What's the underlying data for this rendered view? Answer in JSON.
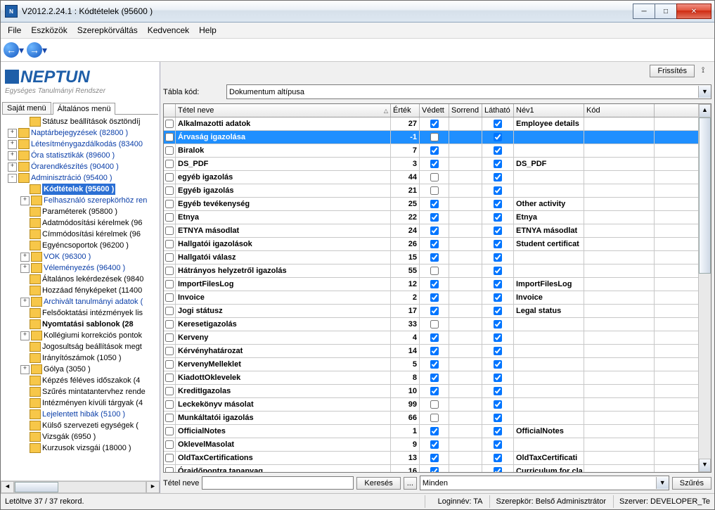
{
  "window": {
    "title": "V2012.2.24.1 : Kódtételek (95600  )"
  },
  "menu": [
    "File",
    "Eszközök",
    "Szerepkörváltás",
    "Kedvencek",
    "Help"
  ],
  "logo": {
    "brand": "NEPTUN",
    "subtitle": "Egységes Tanulmányi Rendszer"
  },
  "left_tabs": {
    "t1": "Saját menü",
    "t2": "Általános menü"
  },
  "tree": [
    {
      "d": 1,
      "tog": "",
      "link": false,
      "bold": false,
      "sel": false,
      "label": "Státusz beállítások ösztöndíj"
    },
    {
      "d": 0,
      "tog": "+",
      "link": true,
      "bold": false,
      "sel": false,
      "label": "Naptárbejegyzések (82800  )"
    },
    {
      "d": 0,
      "tog": "+",
      "link": true,
      "bold": false,
      "sel": false,
      "label": "Létesítménygazdálkodás (83400"
    },
    {
      "d": 0,
      "tog": "+",
      "link": true,
      "bold": false,
      "sel": false,
      "label": "Óra statisztikák (89600  )"
    },
    {
      "d": 0,
      "tog": "+",
      "link": true,
      "bold": false,
      "sel": false,
      "label": "Órarendkészítés (90400  )"
    },
    {
      "d": 0,
      "tog": "-",
      "link": true,
      "bold": false,
      "sel": false,
      "label": "Adminisztráció (95400  )"
    },
    {
      "d": 1,
      "tog": "",
      "link": true,
      "bold": true,
      "sel": true,
      "label": "Kódtételek (95600  )"
    },
    {
      "d": 1,
      "tog": "+",
      "link": true,
      "bold": false,
      "sel": false,
      "label": "Felhasználó szerepkörhöz ren"
    },
    {
      "d": 1,
      "tog": "",
      "link": false,
      "bold": false,
      "sel": false,
      "label": "Paraméterek (95800  )"
    },
    {
      "d": 1,
      "tog": "",
      "link": false,
      "bold": false,
      "sel": false,
      "label": "Adatmódosítási kérelmek (96"
    },
    {
      "d": 1,
      "tog": "",
      "link": false,
      "bold": false,
      "sel": false,
      "label": "Címmódosítási kérelmek (96"
    },
    {
      "d": 1,
      "tog": "",
      "link": false,
      "bold": false,
      "sel": false,
      "label": "Egyéncsoportok (96200  )"
    },
    {
      "d": 1,
      "tog": "+",
      "link": true,
      "bold": false,
      "sel": false,
      "label": "VOK (96300  )"
    },
    {
      "d": 1,
      "tog": "+",
      "link": true,
      "bold": false,
      "sel": false,
      "label": "Véleményezés (96400  )"
    },
    {
      "d": 1,
      "tog": "",
      "link": false,
      "bold": false,
      "sel": false,
      "label": "Általános lekérdezések (9840"
    },
    {
      "d": 1,
      "tog": "",
      "link": false,
      "bold": false,
      "sel": false,
      "label": "Hozzáad fényképeket (11400"
    },
    {
      "d": 1,
      "tog": "+",
      "link": true,
      "bold": false,
      "sel": false,
      "label": "Archivált tanulmányi adatok ("
    },
    {
      "d": 1,
      "tog": "",
      "link": false,
      "bold": false,
      "sel": false,
      "label": "Felsőoktatási intézmények lis"
    },
    {
      "d": 1,
      "tog": "",
      "link": false,
      "bold": true,
      "sel": false,
      "label": "Nyomtatási sablonok (28"
    },
    {
      "d": 1,
      "tog": "+",
      "link": false,
      "bold": false,
      "sel": false,
      "label": "Kollégiumi korrekciós pontok"
    },
    {
      "d": 1,
      "tog": "",
      "link": false,
      "bold": false,
      "sel": false,
      "label": "Jogosultság beállítások megt"
    },
    {
      "d": 1,
      "tog": "",
      "link": false,
      "bold": false,
      "sel": false,
      "label": "Irányítószámok (1050  )"
    },
    {
      "d": 1,
      "tog": "+",
      "link": false,
      "bold": false,
      "sel": false,
      "label": "Gólya (3050  )"
    },
    {
      "d": 1,
      "tog": "",
      "link": false,
      "bold": false,
      "sel": false,
      "label": "Képzés féléves időszakok (4"
    },
    {
      "d": 1,
      "tog": "",
      "link": false,
      "bold": false,
      "sel": false,
      "label": "Szűrés mintatantervhez rende"
    },
    {
      "d": 1,
      "tog": "",
      "link": false,
      "bold": false,
      "sel": false,
      "label": "Intézményen kívüli tárgyak (4"
    },
    {
      "d": 1,
      "tog": "",
      "link": true,
      "bold": false,
      "sel": false,
      "label": "Lejelentett hibák (5100  )"
    },
    {
      "d": 1,
      "tog": "",
      "link": false,
      "bold": false,
      "sel": false,
      "label": "Külső szervezeti egységek ("
    },
    {
      "d": 1,
      "tog": "",
      "link": false,
      "bold": false,
      "sel": false,
      "label": "Vizsgák (6950  )"
    },
    {
      "d": 1,
      "tog": "",
      "link": false,
      "bold": false,
      "sel": false,
      "label": "Kurzusok vizsgái (18000  )"
    }
  ],
  "buttons": {
    "refresh": "Frissítés",
    "search": "Keresés",
    "filter": "Szűrés",
    "more": "..."
  },
  "form": {
    "tablakod_label": "Tábla kód:",
    "tablakod_value": "Dokumentum altípusa"
  },
  "grid": {
    "headers": {
      "name": "Tétel neve",
      "val": "Érték",
      "prot": "Védett",
      "ord": "Sorrend",
      "vis": "Látható",
      "n1": "Név1",
      "code": "Kód"
    },
    "rows": [
      {
        "name": "Alkalmazotti adatok",
        "val": "27",
        "prot": true,
        "vis": true,
        "n1": "Employee details",
        "sel": false
      },
      {
        "name": "Árvaság igazolása",
        "val": "-1",
        "prot": false,
        "vis": true,
        "n1": "",
        "sel": true
      },
      {
        "name": "Biralok",
        "val": "7",
        "prot": true,
        "vis": true,
        "n1": "",
        "sel": false
      },
      {
        "name": "DS_PDF",
        "val": "3",
        "prot": true,
        "vis": true,
        "n1": "DS_PDF",
        "sel": false
      },
      {
        "name": "egyéb igazolás",
        "val": "44",
        "prot": false,
        "vis": true,
        "n1": "",
        "sel": false
      },
      {
        "name": "Egyéb igazolás",
        "val": "21",
        "prot": false,
        "vis": true,
        "n1": "",
        "sel": false
      },
      {
        "name": "Egyéb tevékenység",
        "val": "25",
        "prot": true,
        "vis": true,
        "n1": "Other activity",
        "sel": false
      },
      {
        "name": "Etnya",
        "val": "22",
        "prot": true,
        "vis": true,
        "n1": "Etnya",
        "sel": false
      },
      {
        "name": "ETNYA másodlat",
        "val": "24",
        "prot": true,
        "vis": true,
        "n1": "ETNYA másodlat",
        "sel": false
      },
      {
        "name": "Hallgatói igazolások",
        "val": "26",
        "prot": true,
        "vis": true,
        "n1": "Student certificat",
        "sel": false
      },
      {
        "name": "Hallgatói válasz",
        "val": "15",
        "prot": true,
        "vis": true,
        "n1": "",
        "sel": false
      },
      {
        "name": "Hátrányos helyzetről igazolás",
        "val": "55",
        "prot": false,
        "vis": true,
        "n1": "",
        "sel": false
      },
      {
        "name": "ImportFilesLog",
        "val": "12",
        "prot": true,
        "vis": true,
        "n1": "ImportFilesLog",
        "sel": false
      },
      {
        "name": "Invoice",
        "val": "2",
        "prot": true,
        "vis": true,
        "n1": "Invoice",
        "sel": false
      },
      {
        "name": "Jogi státusz",
        "val": "17",
        "prot": true,
        "vis": true,
        "n1": "Legal status",
        "sel": false
      },
      {
        "name": "Keresetigazolás",
        "val": "33",
        "prot": false,
        "vis": true,
        "n1": "",
        "sel": false
      },
      {
        "name": "Kerveny",
        "val": "4",
        "prot": true,
        "vis": true,
        "n1": "",
        "sel": false
      },
      {
        "name": "Kérvényhatározat",
        "val": "14",
        "prot": true,
        "vis": true,
        "n1": "",
        "sel": false
      },
      {
        "name": "KervenyMelleklet",
        "val": "5",
        "prot": true,
        "vis": true,
        "n1": "",
        "sel": false
      },
      {
        "name": "KiadottOklevelek",
        "val": "8",
        "prot": true,
        "vis": true,
        "n1": "",
        "sel": false
      },
      {
        "name": "KreditIgazolas",
        "val": "10",
        "prot": true,
        "vis": true,
        "n1": "",
        "sel": false
      },
      {
        "name": "Leckekönyv másolat",
        "val": "99",
        "prot": false,
        "vis": true,
        "n1": "",
        "sel": false
      },
      {
        "name": "Munkáltatói igazolás",
        "val": "66",
        "prot": false,
        "vis": true,
        "n1": "",
        "sel": false
      },
      {
        "name": "OfficialNotes",
        "val": "1",
        "prot": true,
        "vis": true,
        "n1": "OfficialNotes",
        "sel": false
      },
      {
        "name": "OklevelMasolat",
        "val": "9",
        "prot": true,
        "vis": true,
        "n1": "",
        "sel": false
      },
      {
        "name": "OldTaxCertifications",
        "val": "13",
        "prot": true,
        "vis": true,
        "n1": "OldTaxCertificati",
        "sel": false
      },
      {
        "name": "Óraidőpontra tananyag",
        "val": "16",
        "prot": true,
        "vis": true,
        "n1": "Curriculum for cla",
        "sel": false
      }
    ]
  },
  "search": {
    "label": "Tétel neve",
    "combo": "Minden"
  },
  "status": {
    "records": "Letöltve 37 / 37 rekord.",
    "login": "Loginnév: TA",
    "role": "Szerepkör: Belső Adminisztrátor",
    "server": "Szerver: DEVELOPER_Te"
  }
}
